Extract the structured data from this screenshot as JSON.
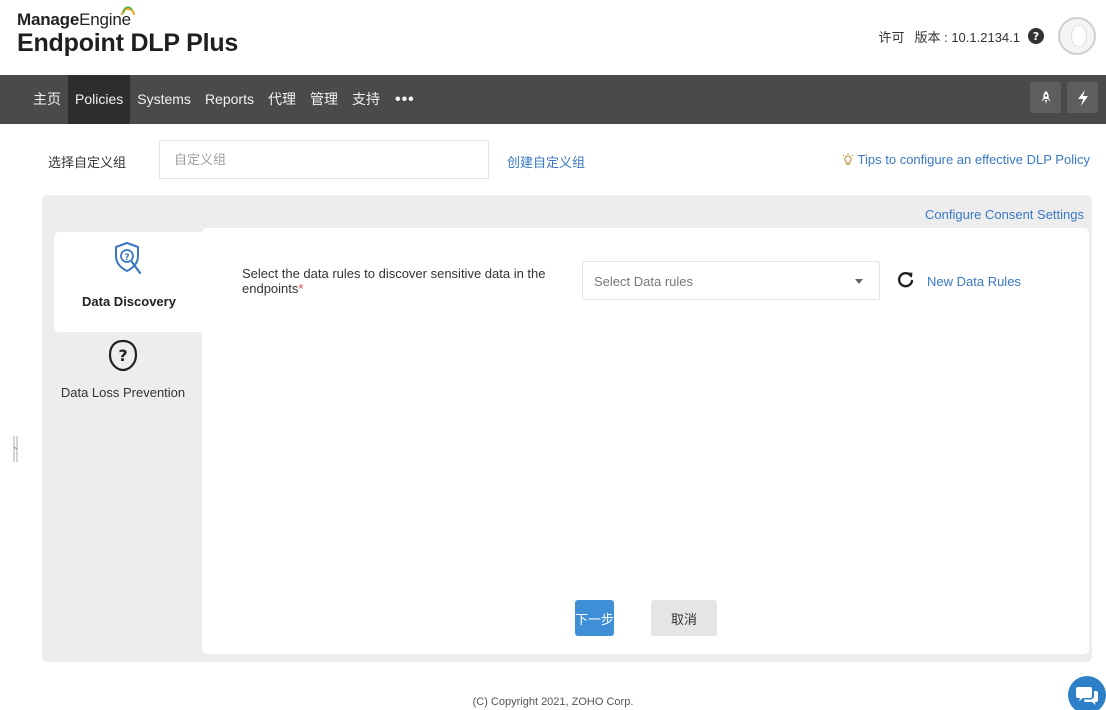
{
  "brand": {
    "company_prefix": "Manage",
    "company_suffix": "Engine",
    "product": "Endpoint DLP Plus"
  },
  "header": {
    "license_label": "许可",
    "version_label": "版本 : 10.1.2134.1",
    "help_icon": "question-circle-icon",
    "avatar_icon": "user-avatar-icon"
  },
  "nav": {
    "items": [
      {
        "label": "主页",
        "active": false
      },
      {
        "label": "Policies",
        "active": true
      },
      {
        "label": "Systems",
        "active": false
      },
      {
        "label": "Reports",
        "active": false
      },
      {
        "label": "代理",
        "active": false
      },
      {
        "label": "管理",
        "active": false
      },
      {
        "label": "支持",
        "active": false
      }
    ],
    "more_label": "•••",
    "quick_icons": [
      "rocket-icon",
      "lightning-icon"
    ]
  },
  "group_row": {
    "label": "选择自定义组",
    "input_placeholder": "自定义组",
    "create_link": "创建自定义组",
    "tips_link": "Tips to configure an effective DLP Policy"
  },
  "panel": {
    "consent_link": "Configure Consent Settings",
    "tabs": [
      {
        "label": "Data Discovery",
        "icon": "search-shield-icon",
        "active": true
      },
      {
        "label": "Data Loss Prevention",
        "icon": "question-shield-icon",
        "active": false
      }
    ],
    "rules": {
      "label": "Select the data rules to discover sensitive data in the endpoints",
      "required_mark": "*",
      "select_placeholder": "Select Data rules",
      "new_rules_link": "New Data Rules"
    },
    "buttons": {
      "next": "下一步",
      "cancel": "取消"
    }
  },
  "footer": {
    "copyright": "(C) Copyright 2021, ZOHO Corp."
  },
  "colors": {
    "navbar": "#4a4a4a",
    "navbar_active": "#2e2e2e",
    "link": "#3a78c2",
    "primary_button": "#3f8fd6",
    "panel_bg": "#ededed",
    "brand_arc": "#f5a623"
  }
}
